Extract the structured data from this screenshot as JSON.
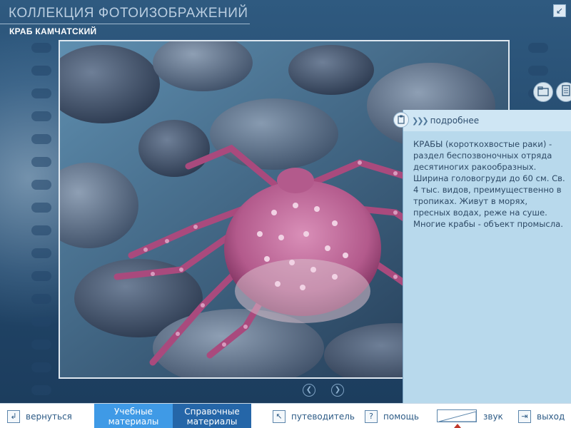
{
  "app": {
    "title": "КОЛЛЕКЦИЯ ФОТОИЗОБРАЖЕНИЙ",
    "subtitle": "КРАБ КАМЧАТСКИЙ"
  },
  "info": {
    "header_label": "подробнее",
    "text": "КРАБЫ (короткохвостые раки) - раздел беспозвоночных отряда десятиногих ракообразных. Ширина головогруди до 60 см. Св. 4 тыс. видов, преимущественно в тропиках. Живут в морях, пресных водах, реже на суше. Многие крабы - объект промысла."
  },
  "footer": {
    "back_label": "вернуться",
    "tab_study": "Учебные материалы",
    "tab_reference": "Справочные материалы",
    "guide_label": "путеводитель",
    "help_label": "помощь",
    "sound_label": "звук",
    "exit_label": "выход"
  },
  "icons": {
    "corner": "collapse-arrow-icon",
    "info_tab": "clipboard-icon",
    "side_1": "folder-icon",
    "side_2": "document-icon",
    "prev": "chevron-left-icon",
    "next": "chevron-right-icon",
    "back": "return-arrow-icon",
    "guide": "cursor-icon",
    "help": "question-icon",
    "exit": "exit-icon"
  },
  "colors": {
    "background": "#2b5478",
    "info_panel": "#b8d9ec",
    "tab_active": "#3f9ae6",
    "tab_secondary": "#2566a8",
    "footer_text": "#2c5a85"
  }
}
